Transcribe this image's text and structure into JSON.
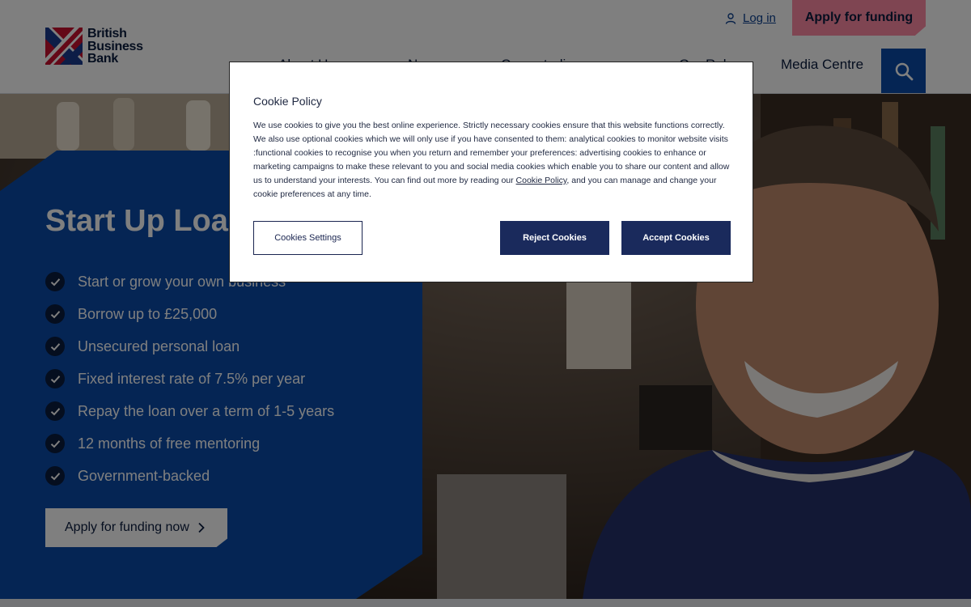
{
  "header": {
    "logo_lines": [
      "British",
      "Business",
      "Bank"
    ],
    "login_label": "Log in",
    "apply_label": "Apply for funding",
    "nav": [
      "About Us",
      "News",
      "Case studies",
      "Our Role",
      "Media Centre"
    ]
  },
  "hero": {
    "title": "Start Up Loans",
    "features": [
      "Start or grow your own business",
      "Borrow up to £25,000",
      "Unsecured personal loan",
      "Fixed interest rate of 7.5% per year",
      "Repay the loan over a term of 1-5 years",
      "12 months of free mentoring",
      "Government-backed"
    ],
    "cta_label": "Apply for funding now"
  },
  "cookie": {
    "title": "Cookie Policy",
    "body_before_link": "We use cookies to give you the best online experience.  Strictly necessary cookies ensure that this website functions correctly.  We also use optional cookies which we will only use if you have consented to them: analytical cookies to monitor website visits :functional cookies to recognise you when you return and remember your preferences: advertising cookies to enhance or marketing campaigns to make these relevant to you and social media cookies which enable you to share our content and allow us to understand your interests.   You can find out more by reading our ",
    "link_label": "Cookie Policy",
    "body_after_link": ", and you can manage and change your cookie preferences at any time.",
    "settings_label": "Cookies Settings",
    "reject_label": "Reject Cookies",
    "accept_label": "Accept Cookies"
  },
  "colors": {
    "brand_blue": "#0a4aa8",
    "navy": "#0a1c3f",
    "pink": "#ff8aa4",
    "cookie_button": "#1a2a5c"
  }
}
